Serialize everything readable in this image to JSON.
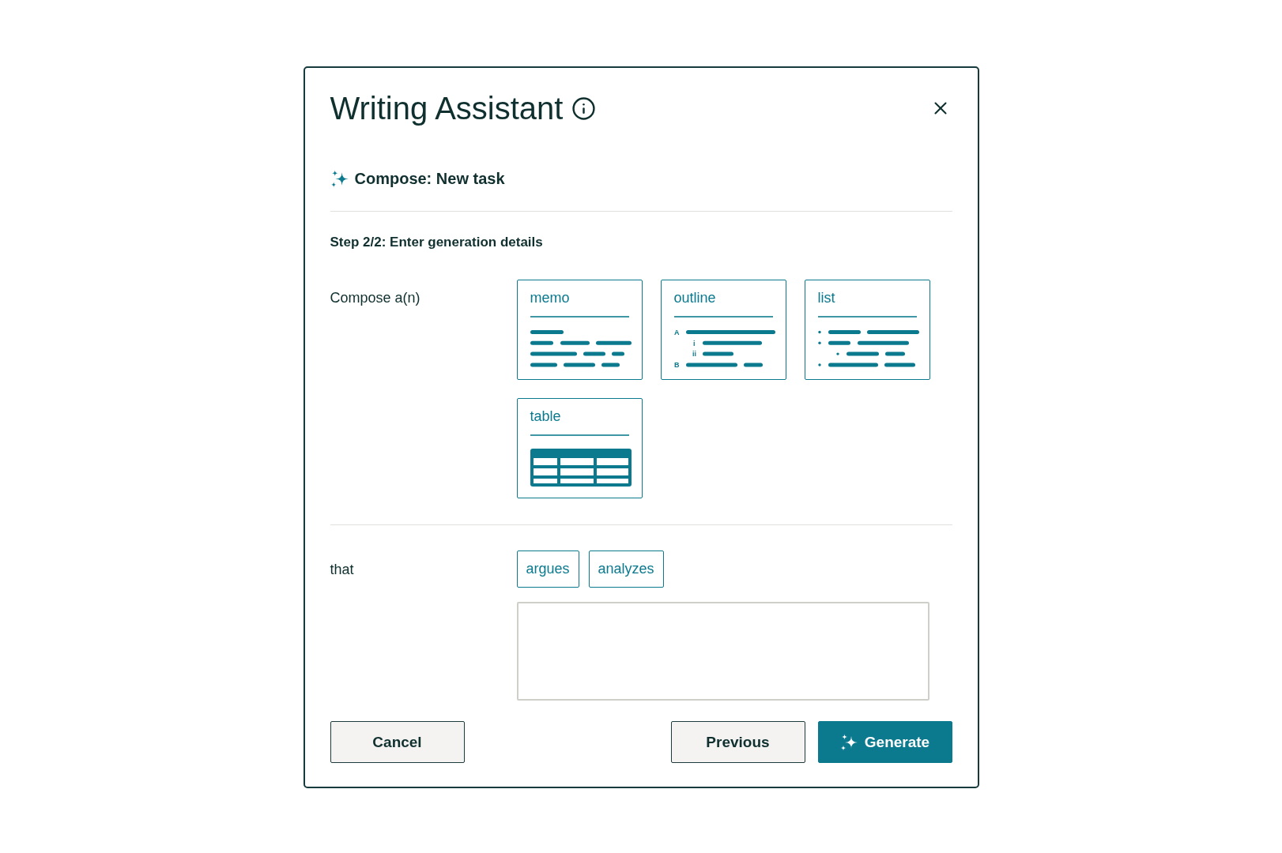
{
  "dialog": {
    "title": "Writing Assistant",
    "task": {
      "title": "Compose: New task"
    },
    "step": "Step 2/2: Enter generation details",
    "format": {
      "label": "Compose a(n)",
      "options": [
        {
          "kind": "memo",
          "label": "memo",
          "selected": false
        },
        {
          "kind": "outline",
          "label": "outline",
          "selected": false,
          "markers": [
            "A",
            "i",
            "ii",
            "B"
          ]
        },
        {
          "kind": "list",
          "label": "list",
          "selected": false
        },
        {
          "kind": "table",
          "label": "table",
          "selected": false
        }
      ]
    },
    "purpose": {
      "label": "that",
      "options": [
        {
          "label": "argues",
          "selected": false
        },
        {
          "label": "analyzes",
          "selected": false
        }
      ]
    },
    "footer": {
      "start": [
        {
          "kind": "secondary",
          "label": "Cancel"
        }
      ],
      "end": [
        {
          "kind": "secondary",
          "label": "Previous"
        },
        {
          "kind": "primary",
          "label": "Generate"
        }
      ]
    }
  }
}
